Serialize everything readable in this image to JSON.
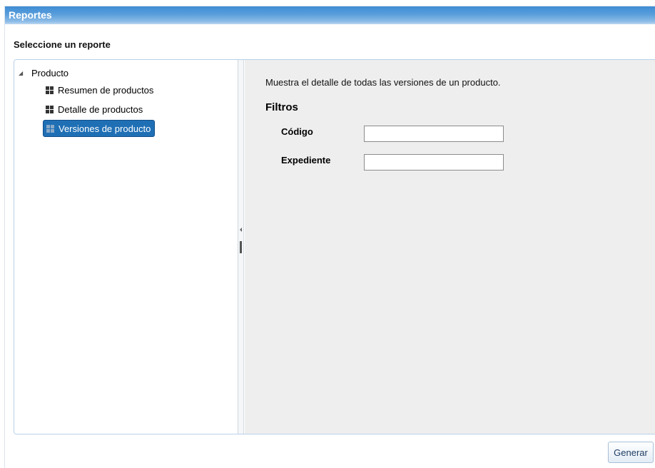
{
  "window": {
    "title": "Reportes"
  },
  "selector": {
    "label": "Seleccione un reporte"
  },
  "tree": {
    "root": {
      "label": "Producto",
      "expanded": true
    },
    "items": [
      {
        "label": "Resumen de productos",
        "icon": "grid-icon",
        "selected": false
      },
      {
        "label": "Detalle de productos",
        "icon": "grid-icon",
        "selected": false
      },
      {
        "label": "Versiones de producto",
        "icon": "grid-icon",
        "selected": true
      }
    ]
  },
  "detail": {
    "description": "Muestra el detalle de todas las versiones de un producto.",
    "filters_title": "Filtros",
    "fields": [
      {
        "label": "Código",
        "value": ""
      },
      {
        "label": "Expediente",
        "value": ""
      }
    ]
  },
  "actions": {
    "generate_label": "Generar"
  },
  "colors": {
    "titlebar": "#3f8cd4",
    "selected_item": "#1f6fb5",
    "right_pane_bg": "#eeeeee",
    "panel_border": "#b8d0ea"
  }
}
